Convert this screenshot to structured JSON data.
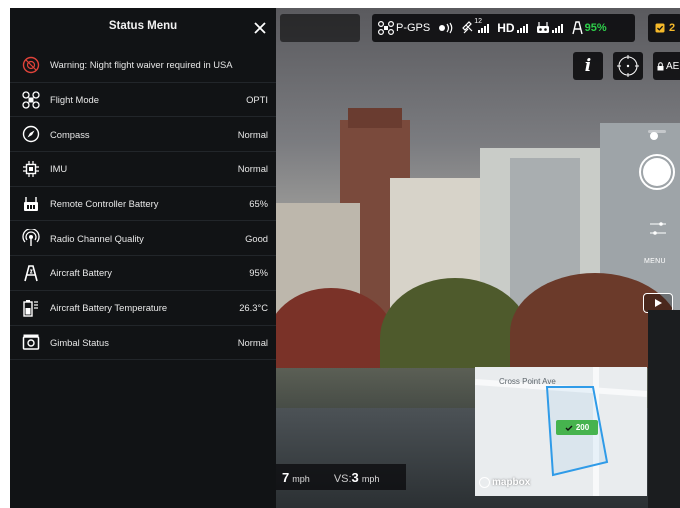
{
  "panel": {
    "title": "Status Menu",
    "close_icon": "close-icon",
    "rows": [
      {
        "icon": "no-fly-warning-icon",
        "label": "Warning: Night flight waiver required in USA",
        "value": ""
      },
      {
        "icon": "drone-icon",
        "label": "Flight Mode",
        "value": "OPTI"
      },
      {
        "icon": "compass-icon",
        "label": "Compass",
        "value": "Normal"
      },
      {
        "icon": "imu-chip-icon",
        "label": "IMU",
        "value": "Normal"
      },
      {
        "icon": "remote-controller-battery-icon",
        "label": "Remote Controller Battery",
        "value": "65%"
      },
      {
        "icon": "radio-channel-icon",
        "label": "Radio Channel Quality",
        "value": "Good"
      },
      {
        "icon": "aircraft-battery-icon",
        "label": "Aircraft Battery",
        "value": "95%"
      },
      {
        "icon": "battery-temperature-icon",
        "label": "Aircraft Battery Temperature",
        "value": "26.3°C"
      },
      {
        "icon": "gimbal-camera-icon",
        "label": "Gimbal Status",
        "value": "Normal"
      }
    ]
  },
  "topbar": {
    "gps_label": "P-GPS",
    "satellite_count": "12",
    "hd_label": "HD",
    "battery_percent": "95%",
    "warning_count": "2",
    "colors": {
      "battery": "#2ecf4a",
      "warning": "#f5b92a"
    }
  },
  "controls": {
    "info_label": "i",
    "ae_label": "AE",
    "menu_label": "MENU"
  },
  "telemetry": {
    "hs_value": "7",
    "hs_unit": "mph",
    "vs_label": "VS:",
    "vs_value": "3",
    "vs_unit": "mph"
  },
  "map": {
    "street_label": "Cross Point Ave",
    "altitude_badge": "200",
    "logo_text": "mapbox",
    "colors": {
      "boundary": "#2f9be8",
      "badge": "#46b34e"
    }
  }
}
